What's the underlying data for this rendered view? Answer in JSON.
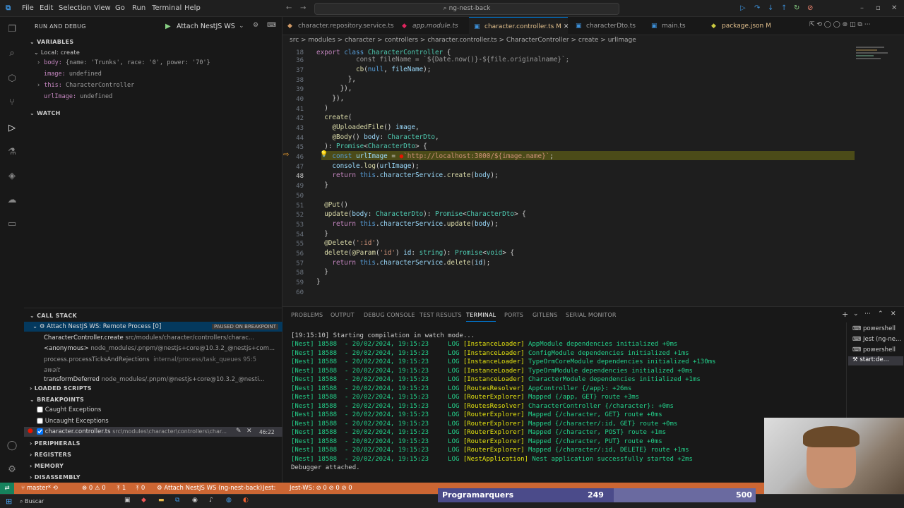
{
  "menu": [
    "File",
    "Edit",
    "Selection",
    "View",
    "Go",
    "Run",
    "Terminal",
    "Help"
  ],
  "search": "ng-nest-back",
  "sidebar": {
    "title": "RUN AND DEBUG",
    "config": "Attach NestJS WS",
    "variables_header": "VARIABLES",
    "scope": "Local: create",
    "vars": [
      {
        "key": "body:",
        "val": "{name: 'Trunks', race: '0', power: '70'}"
      },
      {
        "key": "image:",
        "val": "undefined"
      },
      {
        "key": "this:",
        "val": "CharacterController"
      },
      {
        "key": "urlImage:",
        "val": "undefined"
      }
    ],
    "watch_header": "WATCH",
    "callstack_header": "CALL STACK",
    "process": "Attach NestJS WS: Remote Process [0]",
    "paused": "PAUSED ON BREAKPOINT",
    "frames": [
      {
        "fn": "CharacterController.create",
        "path": "src/modules/character/controllers/charac..."
      },
      {
        "fn": "<anonymous>",
        "path": "node_modules/.pnpm/@nestjs+core@10.3.2_@nestjs+com..."
      },
      {
        "fn": "process.processTicksAndRejections",
        "path": "internal/process/task_queues",
        "extra": "95:5"
      },
      {
        "fn": "await",
        "path": ""
      },
      {
        "fn": "transformDeferred",
        "path": "node_modules/.pnpm/@nestjs+core@10.3.2_@nesti..."
      }
    ],
    "loaded_scripts": "LOADED SCRIPTS",
    "breakpoints_header": "BREAKPOINTS",
    "bp_caught": "Caught Exceptions",
    "bp_uncaught": "Uncaught Exceptions",
    "bp_file": "character.controller.ts",
    "bp_path": "src\\modules\\character\\controllers\\char...",
    "bp_line": "46:22",
    "peripherals": "PERIPHERALS",
    "registers": "REGISTERS",
    "memory": "MEMORY",
    "disassembly": "DISASSEMBLY"
  },
  "tabs": [
    "character.repository.service.ts",
    "app.module.ts",
    "character.controller.ts M",
    "characterDto.ts",
    "main.ts",
    "package.json M"
  ],
  "breadcrumb": "src > modules > character > controllers > character.controller.ts > CharacterController > create > urlImage",
  "panel_tabs": [
    "PROBLEMS",
    "OUTPUT",
    "DEBUG CONSOLE",
    "TEST RESULTS",
    "TERMINAL",
    "PORTS",
    "GITLENS",
    "SERIAL MONITOR"
  ],
  "terminals": [
    "powershell",
    "Jest (ng-ne...",
    "powershell",
    "start:de..."
  ],
  "terminal_lines": [
    {
      "a": "[19:15:10] Starting compilation in watch mode...",
      "b": "",
      "c": ""
    },
    {
      "a": "[Nest] 18588  - 20/02/2024, 19:15:23     LOG ",
      "b": "[InstanceLoader]",
      "c": " AppModule dependencies initialized +0ms"
    },
    {
      "a": "[Nest] 18588  - 20/02/2024, 19:15:23     LOG ",
      "b": "[InstanceLoader]",
      "c": " ConfigModule dependencies initialized +1ms"
    },
    {
      "a": "[Nest] 18588  - 20/02/2024, 19:15:23     LOG ",
      "b": "[InstanceLoader]",
      "c": " TypeOrmCoreModule dependencies initialized +130ms"
    },
    {
      "a": "[Nest] 18588  - 20/02/2024, 19:15:23     LOG ",
      "b": "[InstanceLoader]",
      "c": " TypeOrmModule dependencies initialized +0ms"
    },
    {
      "a": "[Nest] 18588  - 20/02/2024, 19:15:23     LOG ",
      "b": "[InstanceLoader]",
      "c": " CharacterModule dependencies initialized +1ms"
    },
    {
      "a": "[Nest] 18588  - 20/02/2024, 19:15:23     LOG ",
      "b": "[RoutesResolver]",
      "c": " AppController {/app}: +26ms"
    },
    {
      "a": "[Nest] 18588  - 20/02/2024, 19:15:23     LOG ",
      "b": "[RouterExplorer]",
      "c": " Mapped {/app, GET} route +3ms"
    },
    {
      "a": "[Nest] 18588  - 20/02/2024, 19:15:23     LOG ",
      "b": "[RoutesResolver]",
      "c": " CharacterController {/character}: +0ms"
    },
    {
      "a": "[Nest] 18588  - 20/02/2024, 19:15:23     LOG ",
      "b": "[RouterExplorer]",
      "c": " Mapped {/character, GET} route +0ms"
    },
    {
      "a": "[Nest] 18588  - 20/02/2024, 19:15:23     LOG ",
      "b": "[RouterExplorer]",
      "c": " Mapped {/character/:id, GET} route +0ms"
    },
    {
      "a": "[Nest] 18588  - 20/02/2024, 19:15:23     LOG ",
      "b": "[RouterExplorer]",
      "c": " Mapped {/character, POST} route +1ms"
    },
    {
      "a": "[Nest] 18588  - 20/02/2024, 19:15:23     LOG ",
      "b": "[RouterExplorer]",
      "c": " Mapped {/character, PUT} route +0ms"
    },
    {
      "a": "[Nest] 18588  - 20/02/2024, 19:15:23     LOG ",
      "b": "[RouterExplorer]",
      "c": " Mapped {/character/:id, DELETE} route +1ms"
    },
    {
      "a": "[Nest] 18588  - 20/02/2024, 19:15:23     LOG ",
      "b": "[NestApplication]",
      "c": " Nest application successfully started +2ms"
    },
    {
      "a": "Debugger attached.",
      "b": "",
      "c": ""
    }
  ],
  "status": {
    "branch": "master*",
    "errors": "0 ⚠ 0",
    "debug": "1",
    "ports": "0",
    "session": "Attach NestJS WS (ng-nest-back)",
    "jest": "Jest:",
    "jestws": "Jest-WS: ⊘ 0 ⊘ 0 ⊘ 0"
  },
  "taskbar_search": "Buscar",
  "overlay": {
    "name": "Programarquers",
    "score": "249",
    "max": "500"
  },
  "colors": {
    "accent": "#0078d4",
    "status": "#cc6633",
    "breakpoint_line": "#4b4b18"
  }
}
